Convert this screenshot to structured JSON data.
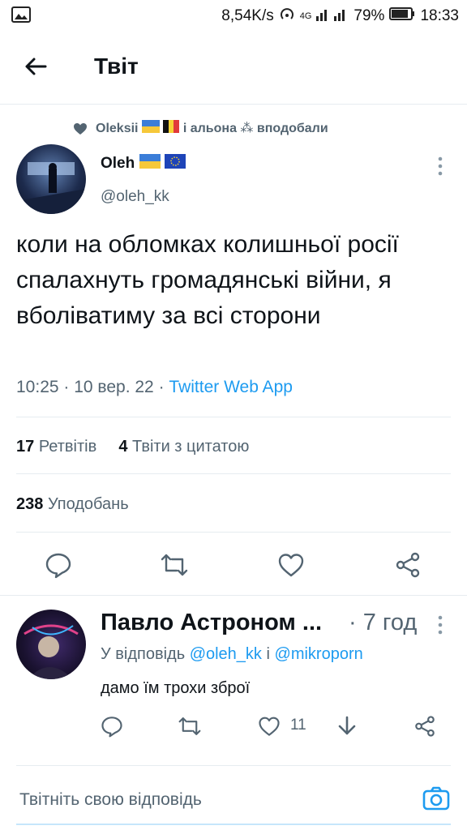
{
  "statusbar": {
    "speed": "8,54K/s",
    "battery": "79%",
    "time": "18:33",
    "network": "4G"
  },
  "header": {
    "title": "Твіт"
  },
  "liked_by": {
    "names": "Oleksii",
    "rest": "і альона",
    "suffix": "вподобали"
  },
  "tweet": {
    "author_name": "Oleh",
    "author_handle": "@oleh_kk",
    "text": "коли на обломках колишньої росії спалахнуть громадянські війни, я вболіватиму за всі сторони",
    "time": "10:25",
    "date": "10 вер. 22",
    "source": "Twitter Web App",
    "retweets": "17",
    "retweets_label": "Ретвітів",
    "quotes": "4",
    "quotes_label": "Твіти з цитатою",
    "likes": "238",
    "likes_label": "Уподобань"
  },
  "reply": {
    "author_name": "Павло Астроном ...",
    "time": "· 7 год",
    "reply_prefix": "У відповідь",
    "mention1": "@oleh_kk",
    "and": "і",
    "mention2": "@mikroporn",
    "text": "дамо їм трохи зброї",
    "likes": "11"
  },
  "compose": {
    "placeholder": "Твітніть свою відповідь"
  },
  "colors": {
    "accent": "#1d9bf0",
    "secondary_text": "#536471",
    "divider": "#e6ecf0"
  }
}
